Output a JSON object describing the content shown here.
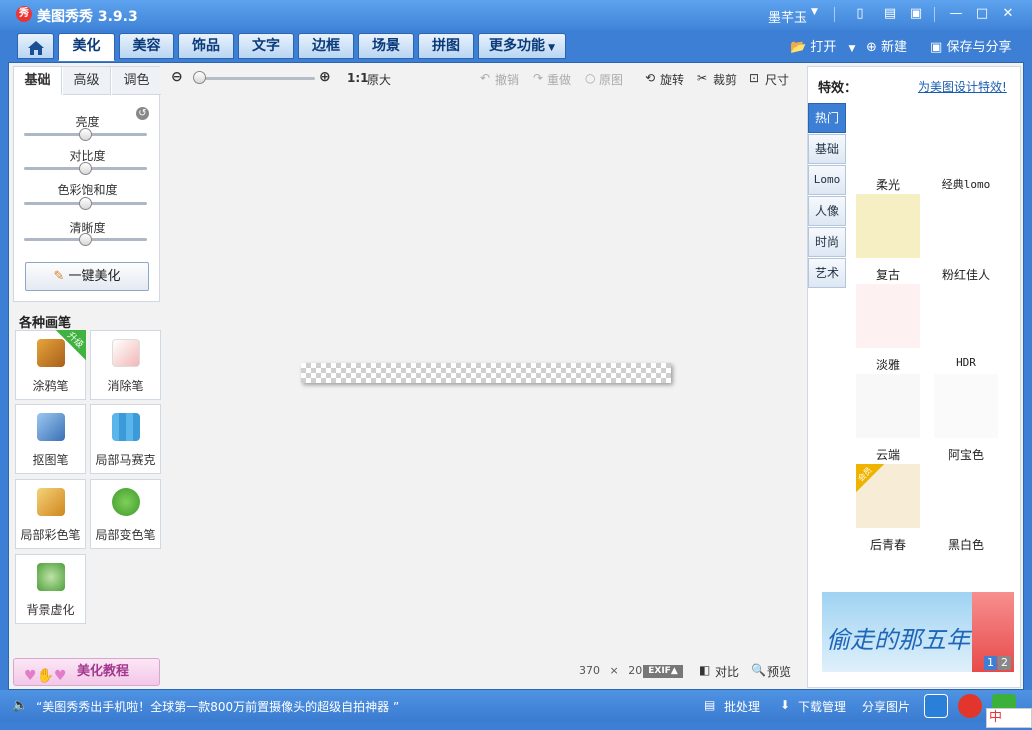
{
  "app": {
    "title": "美图秀秀 3.9.3",
    "logo": "秀",
    "user": "墨芊玉"
  },
  "title_buttons": [
    "minimize-to-tray",
    "feedback",
    "menu",
    "minimize",
    "maximize",
    "close"
  ],
  "tabs": [
    {
      "label": "美化",
      "active": true
    },
    {
      "label": "美容"
    },
    {
      "label": "饰品"
    },
    {
      "label": "文字"
    },
    {
      "label": "边框"
    },
    {
      "label": "场景"
    },
    {
      "label": "拼图"
    },
    {
      "label": "更多功能"
    }
  ],
  "toolbar_right": {
    "open": "打开",
    "new": "新建",
    "save_share": "保存与分享"
  },
  "left": {
    "subtabs": [
      {
        "label": "基础",
        "active": true
      },
      {
        "label": "高级"
      },
      {
        "label": "调色"
      }
    ],
    "sliders": [
      {
        "label": "亮度",
        "value": 0.5
      },
      {
        "label": "对比度",
        "value": 0.5
      },
      {
        "label": "色彩饱和度",
        "value": 0.5
      },
      {
        "label": "清晰度",
        "value": 0.5
      }
    ],
    "one_click": "一键美化",
    "brush_title": "各种画笔",
    "tools": [
      {
        "label": "涂鸦笔",
        "badge": "升级"
      },
      {
        "label": "消除笔"
      },
      {
        "label": "抠图笔"
      },
      {
        "label": "局部马赛克"
      },
      {
        "label": "局部彩色笔"
      },
      {
        "label": "局部变色笔"
      },
      {
        "label": "背景虚化"
      }
    ],
    "tutorial": "美化教程"
  },
  "canvas_toolbar": {
    "ratio": "1:1",
    "original_size": "原大",
    "undo": "撤销",
    "redo": "重做",
    "original": "原图",
    "rotate": "旋转",
    "crop": "裁剪",
    "resize": "尺寸"
  },
  "canvas": {
    "width": "370",
    "times": "×",
    "height": "20",
    "exif": "EXIF▲",
    "compare": "对比",
    "preview": "预览"
  },
  "effects": {
    "title": "特效：",
    "link": "为美图设计特效!",
    "categories": [
      {
        "label": "热门",
        "active": true
      },
      {
        "label": "基础"
      },
      {
        "label": "Lomo"
      },
      {
        "label": "人像"
      },
      {
        "label": "时尚"
      },
      {
        "label": "艺术"
      }
    ],
    "items": [
      {
        "label": "柔光",
        "color": "#ffffff"
      },
      {
        "label": "经典lomo",
        "color": "#ffffff"
      },
      {
        "label": "复古",
        "color": "#f7efc4"
      },
      {
        "label": "粉红佳人",
        "color": "#ffffff"
      },
      {
        "label": "淡雅",
        "color": "#fdf1f2"
      },
      {
        "label": "HDR",
        "color": "#ffffff"
      },
      {
        "label": "云端",
        "color": "#f8f8f8"
      },
      {
        "label": "阿宝色",
        "color": "#fafafa"
      },
      {
        "label": "后青春",
        "color": "#f7ecd6",
        "vip": "会员"
      },
      {
        "label": "黑白色",
        "color": "#ffffff"
      }
    ],
    "banner": {
      "text": "偷走的那五年",
      "page1": "1",
      "page2": "2"
    }
  },
  "status": {
    "news": "“美图秀秀出手机啦！全球第一款800万前置摄像头的超级自拍神器 ”",
    "batch": "批处理",
    "downloads": "下载管理",
    "share": "分享图片",
    "ime": "中"
  }
}
